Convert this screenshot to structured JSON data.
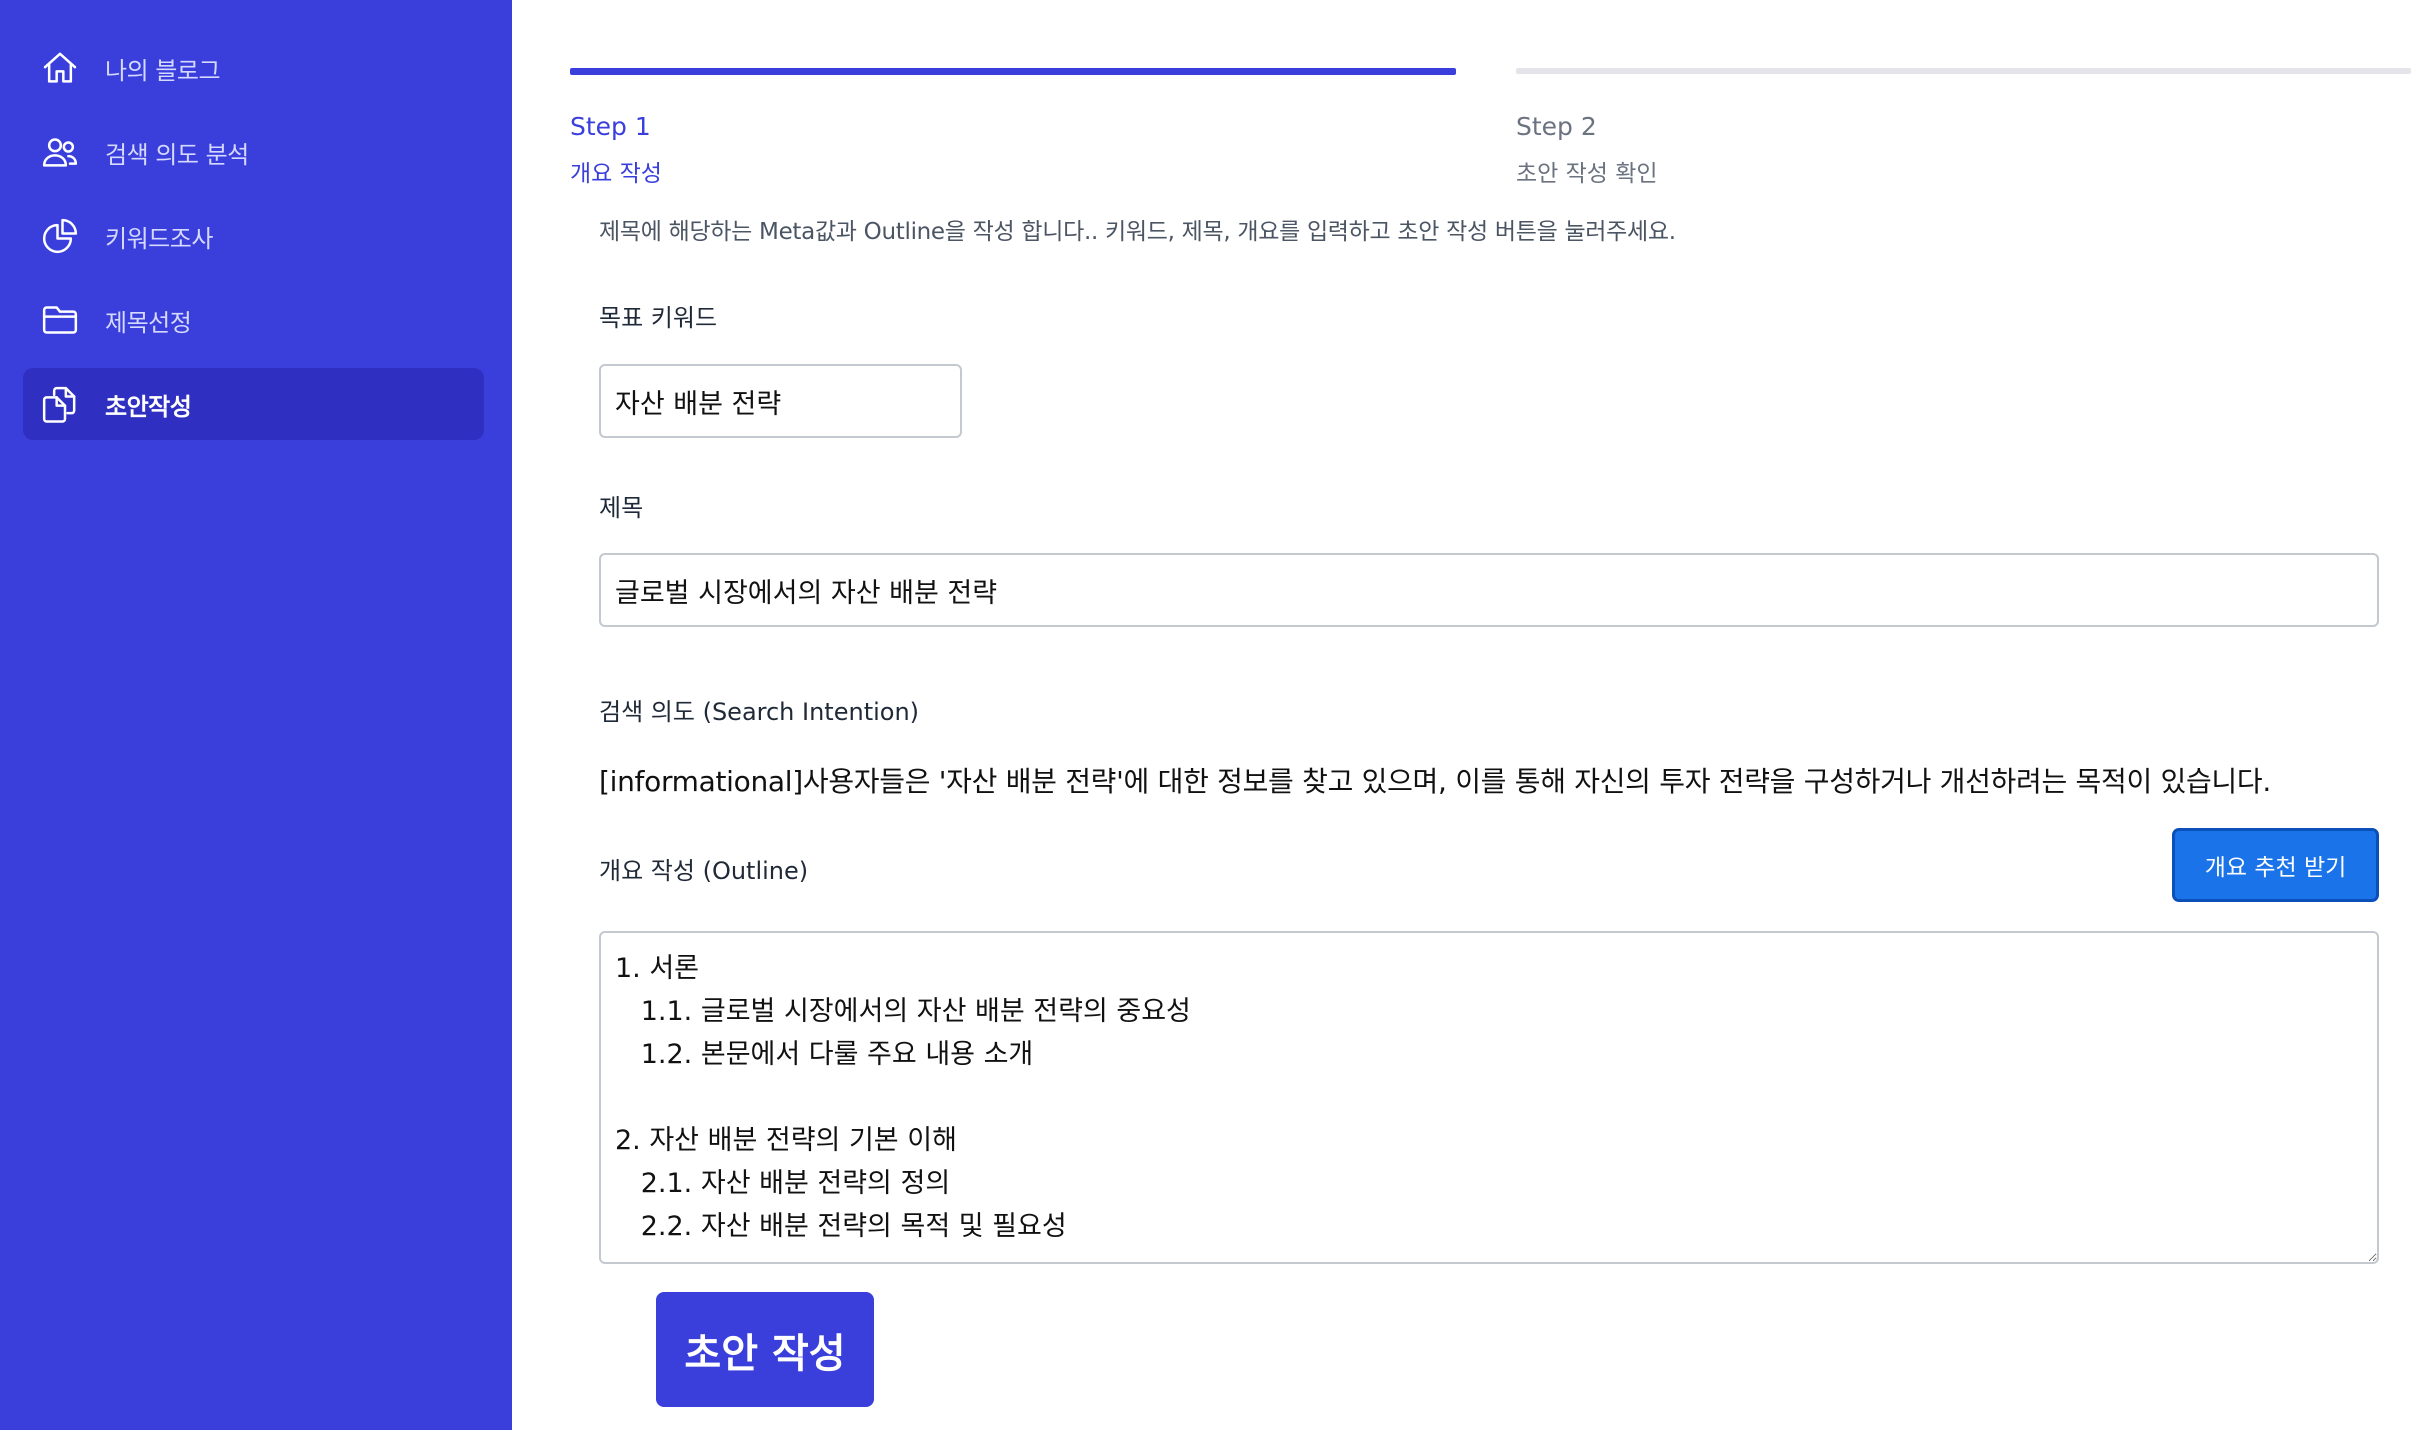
{
  "sidebar": {
    "items": [
      {
        "label": "나의 블로그",
        "icon": "home-icon"
      },
      {
        "label": "검색 의도 분석",
        "icon": "users-icon"
      },
      {
        "label": "키워드조사",
        "icon": "pie-chart-icon"
      },
      {
        "label": "제목선정",
        "icon": "folder-icon"
      },
      {
        "label": "초안작성",
        "icon": "documents-icon",
        "active": true
      }
    ]
  },
  "steps": [
    {
      "title": "Step 1",
      "subtitle": "개요 작성"
    },
    {
      "title": "Step 2",
      "subtitle": "초안 작성 확인"
    }
  ],
  "form": {
    "description": "제목에 해당하는 Meta값과 Outline을 작성 합니다.. 키워드, 제목, 개요를 입력하고 초안 작성 버튼을 눌러주세요.",
    "keyword_label": "목표 키워드",
    "keyword_value": "자산 배분 전략",
    "title_label": "제목",
    "title_value": "글로벌 시장에서의 자산 배분 전략",
    "intent_label": "검색 의도 (Search Intention)",
    "intent_text": "[informational]사용자들은 '자산 배분 전략'에 대한 정보를 찾고 있으며, 이를 통해 자신의 투자 전략을 구성하거나 개선하려는 목적이 있습니다.",
    "outline_label": "개요 작성 (Outline)",
    "suggest_button": "개요 추천 받기",
    "outline_value": "1. 서론\n   1.1. 글로벌 시장에서의 자산 배분 전략의 중요성\n   1.2. 본문에서 다룰 주요 내용 소개\n\n2. 자산 배분 전략의 기본 이해\n   2.1. 자산 배분 전략의 정의\n   2.2. 자산 배분 전략의 목적 및 필요성",
    "submit_button": "초안 작성"
  },
  "colors": {
    "sidebar_bg": "#3a3fdc",
    "sidebar_active": "#2f2fc2",
    "accent": "#3a3fdc",
    "suggest_btn": "#1a73e8"
  }
}
